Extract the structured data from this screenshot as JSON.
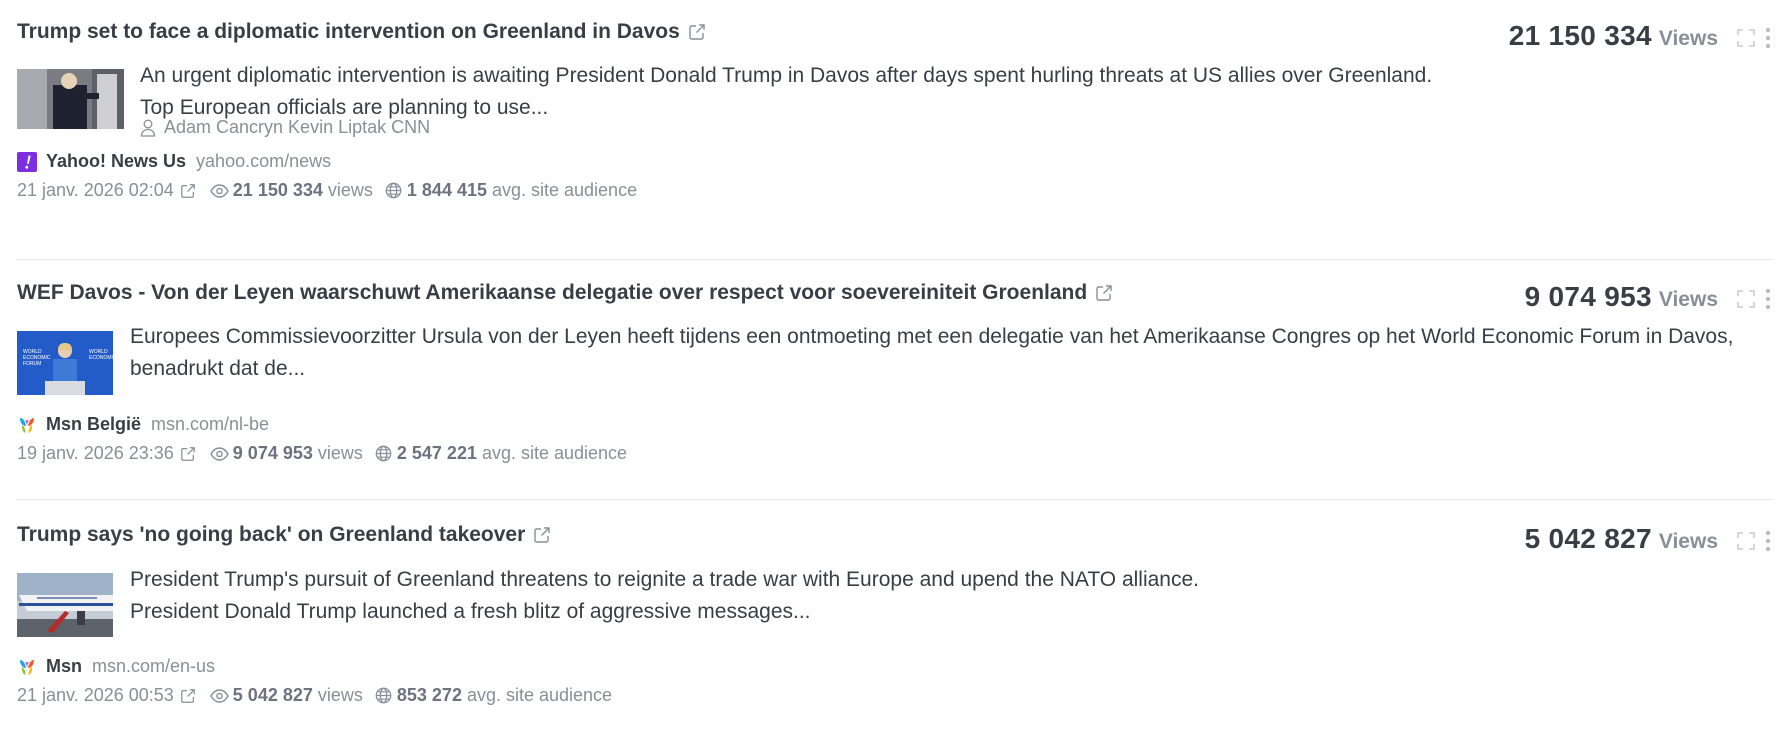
{
  "articles": [
    {
      "title": "Trump set to face a diplomatic intervention on Greenland in Davos",
      "views": "21 150 334",
      "views_label": "Views",
      "description_line1": "An urgent diplomatic intervention is awaiting President Donald Trump in Davos after days spent hurling threats at US allies over Greenland.",
      "description_line2": "Top European officials are planning to use...",
      "author": "Adam Cancryn Kevin Liptak CNN",
      "source_name": "Yahoo! News Us",
      "source_domain": "yahoo.com/news",
      "source_icon": "yahoo-logo-icon",
      "date": "21 janv. 2026 02:04",
      "views_count": "21 150 334",
      "views_word": "views",
      "audience": "1 844 415",
      "audience_label": "avg. site audience"
    },
    {
      "title": "WEF Davos - Von der Leyen waarschuwt Amerikaanse delegatie over respect voor soevereiniteit Groenland",
      "views": "9 074 953",
      "views_label": "Views",
      "description_line1": "Europees Commissievoorzitter Ursula von der Leyen heeft tijdens een ontmoeting met een delegatie van het Amerikaanse Congres op het World Economic Forum in Davos,",
      "description_line2": "benadrukt dat de...",
      "source_name": "Msn België",
      "source_domain": "msn.com/nl-be",
      "source_icon": "msn-logo-icon",
      "date": "19 janv. 2026 23:36",
      "views_count": "9 074 953",
      "views_word": "views",
      "audience": "2 547 221",
      "audience_label": "avg. site audience"
    },
    {
      "title": "Trump says 'no going back' on Greenland takeover",
      "views": "5 042 827",
      "views_label": "Views",
      "description_line1": "President Trump's pursuit of Greenland threatens to reignite a trade war with Europe and upend the NATO alliance.",
      "description_line2": "President Donald Trump launched a fresh blitz of aggressive messages...",
      "source_name": "Msn",
      "source_domain": "msn.com/en-us",
      "source_icon": "msn-logo-icon",
      "date": "21 janv. 2026 00:53",
      "views_count": "5 042 827",
      "views_word": "views",
      "audience": "853 272",
      "audience_label": "avg. site audience"
    }
  ],
  "colors": {
    "text": "#3a3d46",
    "muted": "#8a8e99",
    "divider": "#e4e6ea",
    "yahoo_purple": "#7b2fe0"
  }
}
